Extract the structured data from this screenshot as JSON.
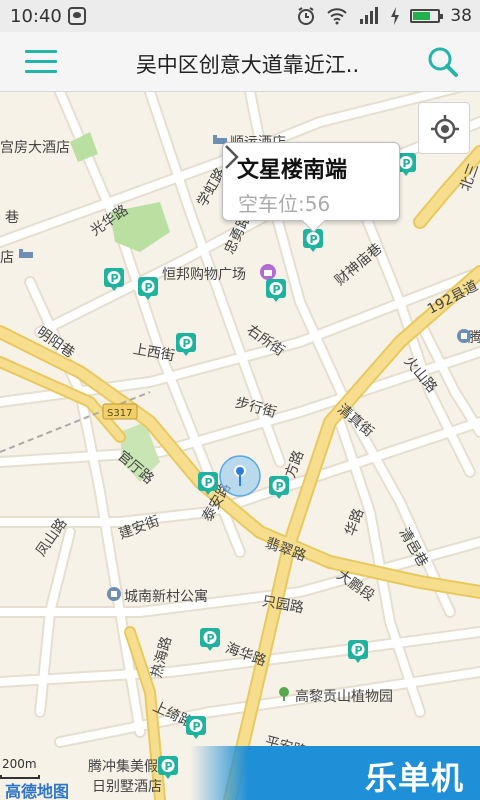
{
  "status_bar": {
    "time": "10:40",
    "battery": "38",
    "icons": [
      "message-icon",
      "alarm-icon",
      "wifi-icon",
      "signal-icon",
      "charging-icon",
      "battery-icon"
    ]
  },
  "app_bar": {
    "title": "吴中区创意大道靠近江..",
    "menu_icon": "menu-icon",
    "search_icon": "search-icon"
  },
  "popup": {
    "title": "文星楼南端",
    "subtitle": "空车位:56"
  },
  "map": {
    "labels": {
      "guest_hotel": "宫房大酒店",
      "shuntian_hotel": "顺运酒店",
      "guanghua_rd": "光华路",
      "wenxing_rd": "学虹路",
      "zhongyong_rd": "忠勇路",
      "beisan": "北三",
      "hotel2": "店",
      "xiang": "巷",
      "hengbang_mall": "恒邦购物广场",
      "caishen_lane": "财神庙巷",
      "county_rd_192": "192县道",
      "mingyang_lane": "明阳巷",
      "shangxi_st": "上西街",
      "yousuo_st": "右所街",
      "huoshan_rd": "火山路",
      "s317": "S317",
      "buxing_st": "步行街",
      "qingzhen_st": "清真街",
      "guanting_rd": "官厅路",
      "taian_rd": "泰安路",
      "tianfang_rd": "方路",
      "fengshan_rd": "凤山路",
      "jianan_st": "建安街",
      "feicui_rd": "翡翠路",
      "huahua_rd": "华路",
      "qingyi_lane": "清邑巷",
      "dapeng_rd": "大鹏段",
      "chengnan_apt": "城南新村公寓",
      "zhiyuan_rd": "只园路",
      "rehai_rd": "热海路",
      "haihua_rd": "海华路",
      "gaoli_park": "高黎贡山植物园",
      "shangyu_rd": "上绮路",
      "pingan_rd": "平安路",
      "tengchong_hotel": "腾冲集美假",
      "villa_hotel": "日别墅酒店",
      "right_edge": "腾"
    },
    "scale": "200m",
    "logo": "高德地图",
    "watermark": "乐单机",
    "colors": {
      "accent": "#22b5aa",
      "parking": "#1fb39f",
      "user_dot": "#2d7be0",
      "main_road": "#f3d77c",
      "water": "#8fd1f0",
      "green": "#b9dfa1"
    }
  }
}
